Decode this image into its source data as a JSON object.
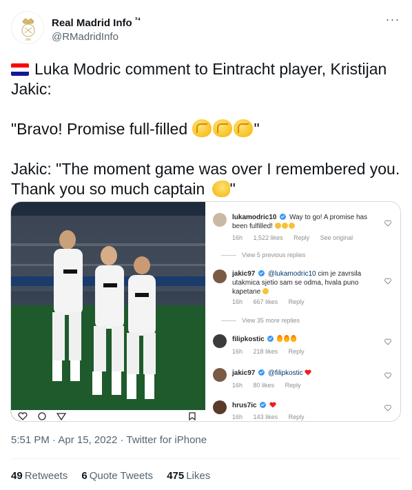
{
  "author": {
    "display_name": "Real Madrid Info",
    "superscript": "³⁴",
    "handle": "@RMadridInfo"
  },
  "header": {
    "more_label": "···"
  },
  "tweet": {
    "line1": "Luka Modric comment to Eintracht player, Kristijan Jakic:",
    "line2": "\"Bravo! Promise full-filled",
    "line2_end": "\"",
    "line3": "Jakic: \"The moment game was over I remembered you. Thank you so much captain",
    "line3_end": "\"",
    "flag_icon": "croatia-flag-icon",
    "emoji_claps": "clapping-hands-emoji x3",
    "emoji_arm": "flexed-biceps-emoji"
  },
  "media": {
    "photo_alt_icon": "football-players-photo",
    "comments": [
      {
        "user": "lukamodric10",
        "verified": true,
        "text": "Way to go! A promise has been fulfilled!",
        "time": "16h",
        "likes": "1,522 likes",
        "reply": "Reply",
        "extra": "See original"
      },
      {
        "view_more": "View 5 previous replies"
      },
      {
        "user": "jakic97",
        "verified": true,
        "mention": "@lukamodric10",
        "text": "cim je zavrsila utakmica sjetio sam se odma, hvala puno kapetane",
        "time": "16h",
        "likes": "667 likes",
        "reply": "Reply"
      },
      {
        "view_more": "View 35 more replies"
      },
      {
        "user": "filipkostic",
        "verified": true,
        "text": "",
        "time": "16h",
        "likes": "218 likes",
        "reply": "Reply"
      },
      {
        "user": "jakic97",
        "verified": true,
        "mention": "@filipkostic",
        "text": "",
        "time": "16h",
        "likes": "80 likes",
        "reply": "Reply"
      },
      {
        "user": "hrus7ic",
        "verified": true,
        "text": "",
        "time": "16h",
        "likes": "143 likes",
        "reply": "Reply"
      }
    ]
  },
  "footer": {
    "time": "5:51 PM",
    "separator": "·",
    "date": "Apr 15, 2022",
    "source": "Twitter for iPhone",
    "retweets_count": "49",
    "retweets_label": "Retweets",
    "quotes_count": "6",
    "quotes_label": "Quote Tweets",
    "likes_count": "475",
    "likes_label": "Likes"
  },
  "colors": {
    "text_primary": "#0f1419",
    "text_secondary": "#536471",
    "border": "#cfd9de",
    "divider": "#eff3f4",
    "instagram_link": "#00376b",
    "verified": "#3897f0"
  }
}
